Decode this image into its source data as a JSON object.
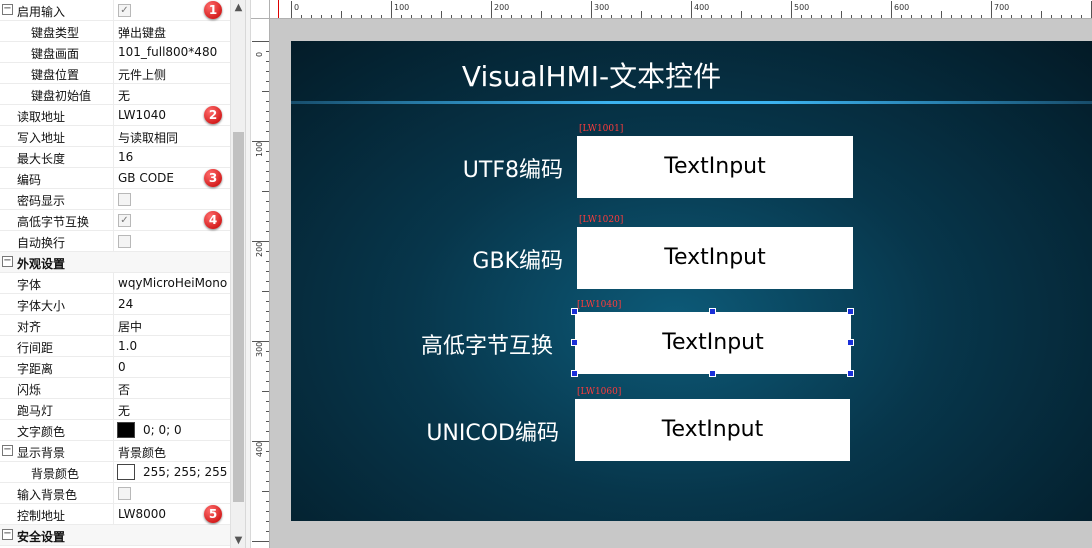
{
  "property_grid": {
    "rows": [
      {
        "label": "启用输入",
        "toggle": "⊟",
        "kind": "check",
        "checked": true,
        "badge": "1"
      },
      {
        "label": "键盘类型",
        "value": "弹出键盘"
      },
      {
        "label": "键盘画面",
        "value": "101_full800*480"
      },
      {
        "label": "键盘位置",
        "value": "元件上侧"
      },
      {
        "label": "键盘初始值",
        "value": "无"
      },
      {
        "label": "读取地址",
        "value": "LW1040",
        "badge": "2"
      },
      {
        "label": "写入地址",
        "value": "与读取相同"
      },
      {
        "label": "最大长度",
        "value": "16"
      },
      {
        "label": "编码",
        "value": "GB CODE",
        "badge": "3"
      },
      {
        "label": "密码显示",
        "kind": "check",
        "checked": false
      },
      {
        "label": "高低字节互换",
        "kind": "check",
        "checked": true,
        "badge": "4"
      },
      {
        "label": "自动换行",
        "kind": "check",
        "checked": false
      },
      {
        "label": "外观设置",
        "toggle": "⊟",
        "kind": "group"
      },
      {
        "label": "字体",
        "value": "wqyMicroHeiMono"
      },
      {
        "label": "字体大小",
        "value": "24"
      },
      {
        "label": "对齐",
        "value": "居中"
      },
      {
        "label": "行间距",
        "value": "1.0"
      },
      {
        "label": "字距离",
        "value": "0"
      },
      {
        "label": "闪烁",
        "value": "否"
      },
      {
        "label": "跑马灯",
        "value": "无"
      },
      {
        "label": "文字颜色",
        "kind": "color",
        "swatch": "#000000",
        "value": "0; 0; 0"
      },
      {
        "label": "显示背景",
        "toggle": "⊟",
        "value": "背景颜色"
      },
      {
        "label": "背景颜色",
        "kind": "color",
        "swatch": "#ffffff",
        "value": "255; 255; 255",
        "indent": true
      },
      {
        "label": "输入背景色",
        "kind": "check",
        "checked": false
      },
      {
        "label": "控制地址",
        "value": "LW8000",
        "badge": "5"
      },
      {
        "label": "安全设置",
        "toggle": "⊟",
        "kind": "group"
      }
    ],
    "scroll_up_icon": "▲",
    "scroll_down_icon": "▼"
  },
  "rulers": {
    "horizontal": [
      "0",
      "100",
      "200",
      "300",
      "400",
      "500",
      "600",
      "700"
    ],
    "vertical": [
      "0",
      "100",
      "200",
      "300",
      "400"
    ]
  },
  "screen": {
    "title": "VisualHMI-文本控件",
    "rows": [
      {
        "label": "UTF8编码",
        "address": "[LW1001]",
        "text": "TextInput",
        "selected": false
      },
      {
        "label": "GBK编码",
        "address": "[LW1020]",
        "text": "TextInput",
        "selected": false
      },
      {
        "label": "高低字节互换",
        "address": "[LW1040]",
        "text": "TextInput",
        "selected": true
      },
      {
        "label": "UNICOD编码",
        "address": "[LW1060]",
        "text": "TextInput",
        "selected": false
      }
    ]
  },
  "colors": {
    "badge": "#d40000",
    "selection_handle": "#1a2fd8",
    "address_tag": "#ff3b3b",
    "title_rule": "#3cb3f0"
  }
}
